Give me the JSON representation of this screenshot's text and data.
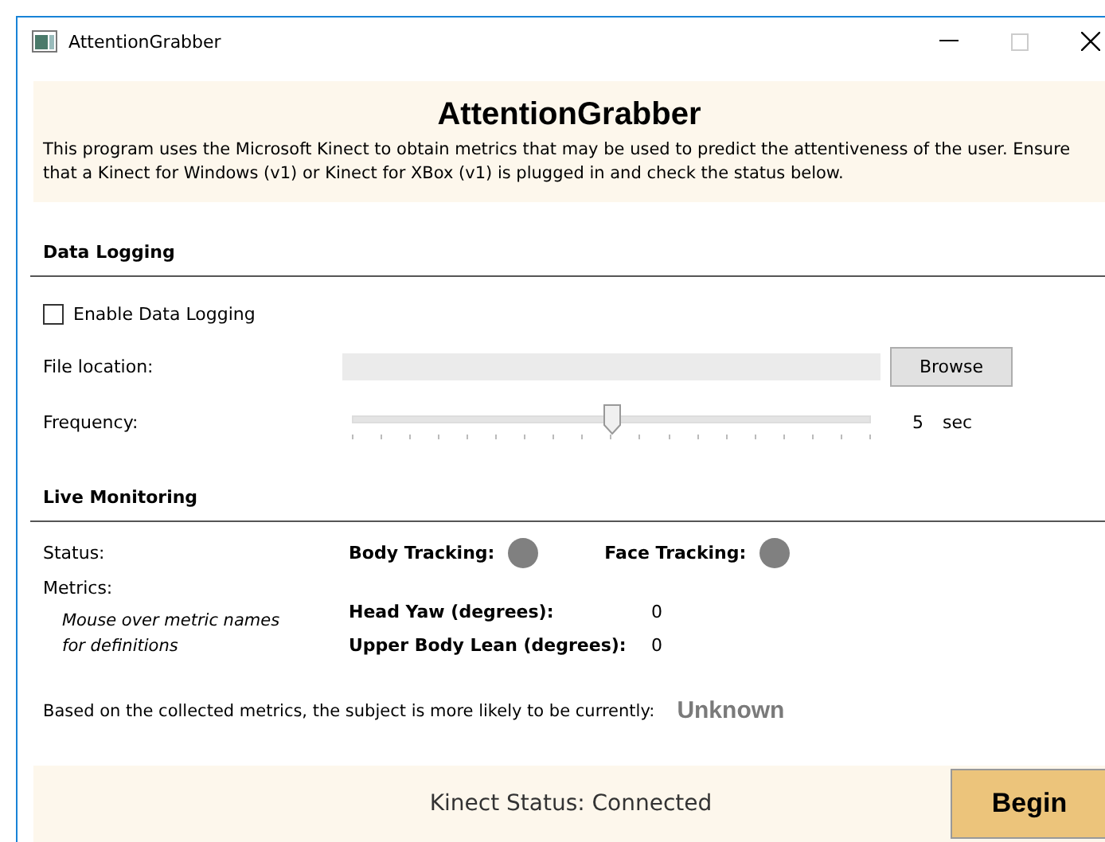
{
  "window": {
    "title": "AttentionGrabber"
  },
  "header": {
    "title": "AttentionGrabber",
    "description": "This program uses the Microsoft Kinect to obtain metrics that may be used to predict the attentiveness of the user. Ensure that a Kinect for Windows (v1) or Kinect for XBox (v1) is plugged in and check the status below."
  },
  "data_logging": {
    "heading": "Data Logging",
    "enable": {
      "label": "Enable Data Logging",
      "checked": false
    },
    "file_location": {
      "label": "File location:",
      "button": "Browse"
    },
    "frequency": {
      "label": "Frequency:",
      "level": 0.5,
      "value": "5",
      "unit": "sec"
    }
  },
  "live_monitoring": {
    "heading": "Live Monitoring",
    "status_label": "Status:",
    "trackers": [
      {
        "label": "Body Tracking:",
        "color": "#808080"
      },
      {
        "label": "Face Tracking:",
        "color": "#808080"
      }
    ],
    "metrics_label": "Metrics:",
    "metrics_hint": "Mouse over metric names for definitions",
    "metrics": [
      {
        "name": "Head Yaw (degrees):",
        "value": "0"
      },
      {
        "name": "Upper Body Lean (degrees):",
        "value": "0"
      }
    ],
    "prediction_label": "Based on the collected metrics, the subject is more likely to be currently:",
    "prediction": "Unknown"
  },
  "footer": {
    "status": "Kinect Status: Connected",
    "button": "Begin"
  }
}
